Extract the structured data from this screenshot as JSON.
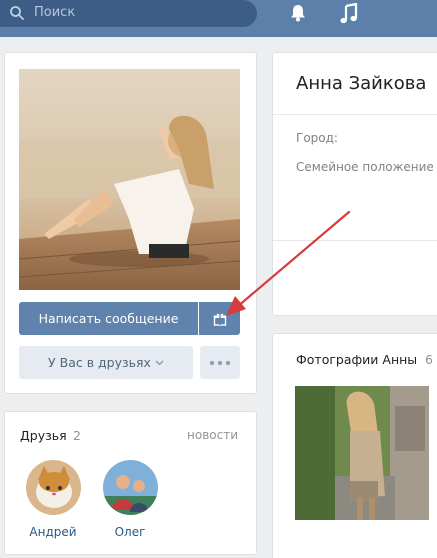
{
  "header": {
    "search_placeholder": "Поиск",
    "icons": [
      "search-icon",
      "bell-icon",
      "music-icon"
    ]
  },
  "profile": {
    "send_message_label": "Написать сообщение",
    "gift_icon": "gift-icon",
    "friend_status_label": "У Вас в друзьях",
    "more_icon": "more-icon"
  },
  "friends": {
    "title": "Друзья",
    "count": "2",
    "link": "новости",
    "items": [
      {
        "name": "Андрей"
      },
      {
        "name": "Олег"
      }
    ]
  },
  "info": {
    "name": "Анна Зайкова",
    "fields": [
      {
        "label": "Город:"
      },
      {
        "label": "Семейное положение"
      }
    ]
  },
  "photos": {
    "title": "Фотографии Анны",
    "count": "6"
  },
  "colors": {
    "header": "#5d80ab",
    "search_bg": "#3d5d86",
    "primary_button": "#5f83ad",
    "secondary_button": "#e5ebf1",
    "link": "#2a5885",
    "annotation_arrow": "#d63c3c"
  }
}
